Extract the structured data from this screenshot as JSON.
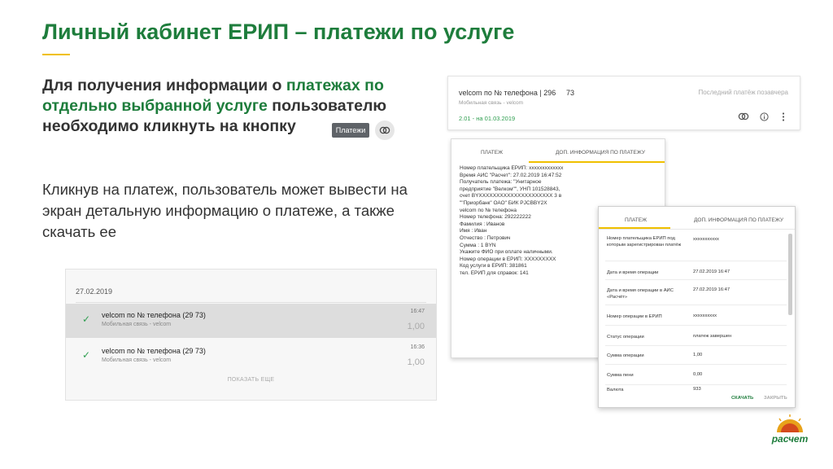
{
  "slide": {
    "title": "Личный кабинет ЕРИП – платежи по услуге",
    "para1_a": "Для получения информации о ",
    "para1_hl": "платежах по отдельно выбранной услуге",
    "para1_b": " пользователю необходимо кликнуть на кнопку",
    "button_payments": "Платежи",
    "para2": "Кликнув на платеж, пользователь может вывести на экран детальную информацию о платеже, а также скачать ее"
  },
  "list": {
    "date": "27.02.2019",
    "rows": [
      {
        "title": "velcom по № телефона (29          73)",
        "sub": "Мобильная связь - velcom",
        "time": "16:47",
        "amount": "1,00"
      },
      {
        "title": "velcom по № телефона (29          73)",
        "sub": "Мобильная связь - velcom",
        "time": "16:36",
        "amount": "1,00"
      }
    ],
    "more": "ПОКАЗАТЬ ЕЩЕ"
  },
  "top_card": {
    "name": "velcom по № телефона | 296",
    "name2": "73",
    "sub": "Мобильная связь - velcom",
    "last": "Последний платёж позавчера",
    "date": "2.01 - на 01.03.2019"
  },
  "mid_card": {
    "tab1": "ПЛАТЕЖ",
    "tab2": "ДОП. ИНФОРМАЦИЯ ПО ПЛАТЕЖУ",
    "lines": [
      "Номер плательщика ЕРИП: xxxxxxxxxxxxx",
      "Время АИС \"Расчет\": 27.02.2019 16:47:52",
      "Получатель платежа: \"Унитарное",
      "предприятие \"Велком\"\", УНП 101528843,",
      "счет BYXXXXXXXXXXXXXXXXXXXXX 3 в",
      "\"\"Приорбанк\" ОАО\" БИК PJCBBY2X",
      "velcom по № телефона",
      "Номер телефона: 292222222",
      "Фамилия : Иванов",
      "Имя : Иван",
      "Отчество : Петрович",
      "Сумма : 1 BYN",
      "Укажите ФИО при оплате наличными.",
      "Номер операции в ЕРИП: XXXXXXXXX",
      "Код услуги в ЕРИП: 381861",
      "тел. ЕРИП для справок: 141"
    ]
  },
  "right_card": {
    "tab1": "ПЛАТЕЖ",
    "tab2": "ДОП. ИНФОРМАЦИЯ ПО ПЛАТЕЖУ",
    "rows": [
      {
        "k": "Номер плательщика ЕРИП под которым зарегистрирован платёж",
        "v": "xxxxxxxxxxx"
      },
      {
        "k": "Дата и время операции",
        "v": "27.02.2019 16:47"
      },
      {
        "k": "Дата и время операции в АИС «Расчёт»",
        "v": "27.02.2019 16:47"
      },
      {
        "k": "Номер операции в ЕРИП",
        "v": "xxxxxxxxxx"
      },
      {
        "k": "Статус операции",
        "v": "платеж завершен"
      },
      {
        "k": "Сумма операции",
        "v": "1,00"
      },
      {
        "k": "Сумма пени",
        "v": "0,00"
      },
      {
        "k": "Валюта",
        "v": "933"
      }
    ],
    "download": "СКАЧАТЬ",
    "close": "ЗАКРЫТЬ"
  },
  "logo": {
    "text": "расчет"
  },
  "colors": {
    "green": "#1e7d3c",
    "accent": "#f0c000",
    "check": "#2e9e4f"
  }
}
